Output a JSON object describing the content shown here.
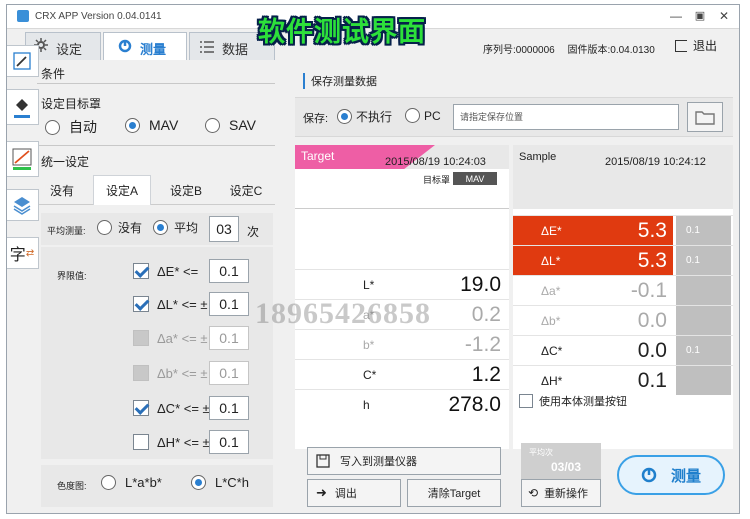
{
  "window": {
    "title": "CRX APP Version 0.04.0141",
    "minimize": "—",
    "maximize": "▣",
    "close": "✕"
  },
  "banner": "软件测试界面",
  "tabs": [
    {
      "label": "设定",
      "icon": "gear-icon"
    },
    {
      "label": "测量",
      "icon": "measure-icon"
    },
    {
      "label": "数据",
      "icon": "list-icon"
    }
  ],
  "header": {
    "serial_label": "序列号:",
    "serial": "0000006",
    "firmware_label": "固件版本:",
    "firmware": "0.04.0130",
    "exit_label": "退出"
  },
  "sidebar": [
    "pen-icon",
    "fill-bucket-icon",
    "line-icon",
    "layers-icon",
    "text-icon"
  ],
  "left": {
    "conditions_title": "条件",
    "target_title": "设定目标罩",
    "target_options": [
      "自动",
      "MAV",
      "SAV"
    ],
    "target_selected": "MAV",
    "unify_title": "统一设定",
    "set_buttons": [
      "没有",
      "设定A",
      "设定B",
      "设定C"
    ],
    "set_active": "设定A",
    "avg_label": "平均测量:",
    "avg_none": "没有",
    "avg_avg": "平均",
    "avg_count": "03",
    "avg_unit": "次",
    "limit_label": "界限值:",
    "limits": [
      {
        "label": "ΔE* <=",
        "value": "0.1",
        "checked": true,
        "enabled": true
      },
      {
        "label": "ΔL* <= ±",
        "value": "0.1",
        "checked": true,
        "enabled": true
      },
      {
        "label": "Δa* <= ±",
        "value": "0.1",
        "checked": false,
        "enabled": false
      },
      {
        "label": "Δb* <= ±",
        "value": "0.1",
        "checked": false,
        "enabled": false
      },
      {
        "label": "ΔC* <= ±",
        "value": "0.1",
        "checked": true,
        "enabled": true
      },
      {
        "label": "ΔH* <= ±",
        "value": "0.1",
        "checked": false,
        "enabled": true
      }
    ],
    "colorspace_label": "色度图:",
    "colorspace_options": [
      "L*a*b*",
      "L*C*h"
    ],
    "colorspace_selected": "L*C*h"
  },
  "right": {
    "save_title": "保存测量数据",
    "save_label": "保存:",
    "save_opt1": "不执行",
    "save_opt2": "PC",
    "path_placeholder": "请指定保存位置",
    "target_label": "Target",
    "target_date": "2015/08/19 10:24:03",
    "target_std_label": "目标罩",
    "target_std_value": "MAV",
    "sample_label": "Sample",
    "sample_date": "2015/08/19 10:24:12",
    "target_rows": [
      {
        "name": "L*",
        "value": "19.0",
        "dim": false
      },
      {
        "name": "a*",
        "value": "0.2",
        "dim": true
      },
      {
        "name": "b*",
        "value": "-1.2",
        "dim": true
      },
      {
        "name": "C*",
        "value": "1.2",
        "dim": false
      },
      {
        "name": "h",
        "value": "278.0",
        "dim": false
      }
    ],
    "sample_rows": [
      {
        "name": "ΔE*",
        "value": "5.3",
        "tol": "0.1",
        "red": true,
        "dim": false
      },
      {
        "name": "ΔL*",
        "value": "5.3",
        "tol": "0.1",
        "red": true,
        "dim": false
      },
      {
        "name": "Δa*",
        "value": "-0.1",
        "tol": "",
        "red": false,
        "dim": true
      },
      {
        "name": "Δb*",
        "value": "0.0",
        "tol": "",
        "red": false,
        "dim": true
      },
      {
        "name": "ΔC*",
        "value": "0.0",
        "tol": "0.1",
        "red": false,
        "dim": false
      },
      {
        "name": "ΔH*",
        "value": "0.1",
        "tol": "",
        "red": false,
        "dim": false
      }
    ],
    "use_body_button": "使用本体测量按钮",
    "write_btn": "写入到测量仪器",
    "recall_btn": "调出",
    "clear_btn": "清除Target",
    "avg_count_label": "平均次",
    "avg_progress": "03/03",
    "redo_btn": "重新操作",
    "measure_btn": "测量"
  },
  "watermark": "18965426858",
  "colors": {
    "accent": "#2a7fd0",
    "alert": "#e03a10",
    "target_tab": "#ee5ea5",
    "banner": "#2de03a"
  }
}
